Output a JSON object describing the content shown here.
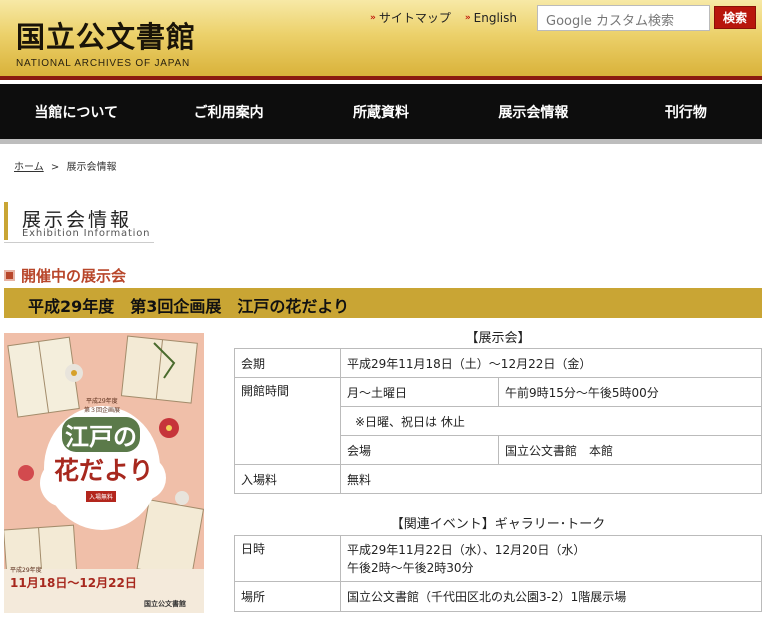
{
  "header": {
    "logo_jp": "国立公文書館",
    "logo_en": "NATIONAL ARCHIVES OF JAPAN",
    "links": [
      {
        "label": "サイトマップ"
      },
      {
        "label": "English"
      }
    ],
    "search_placeholder": "Google カスタム検索",
    "search_button": "検索"
  },
  "nav": {
    "items": [
      {
        "label": "当館について"
      },
      {
        "label": "ご利用案内"
      },
      {
        "label": "所蔵資料"
      },
      {
        "label": "展示会情報"
      },
      {
        "label": "刊行物"
      }
    ]
  },
  "breadcrumb": {
    "home": "ホーム",
    "separator": ">",
    "current": "展示会情報"
  },
  "page_title": {
    "jp": "展示会情報",
    "en": "Exhibition Information"
  },
  "section": {
    "heading": "開催中の展示会"
  },
  "exhibition": {
    "title": "平成29年度　第3回企画展　江戸の花だより",
    "poster": {
      "small_top": "平成29年度",
      "small_sub": "第３回企画展",
      "title_line1": "江戸の",
      "title_line2": "花だより",
      "badge": "入場無料",
      "year": "平成29年度",
      "date_start": "11月18日",
      "date_end": "12月22日",
      "footer_name": "国立公文書館"
    },
    "table1": {
      "caption": "【展示会】",
      "rows": {
        "period_label": "会期",
        "period_value": "平成29年11月18日（土）～12月22日（金）",
        "hours_label": "開館時間",
        "hours_days": "月～土曜日",
        "hours_time": "午前9時15分～午後5時00分",
        "hours_note": "※日曜、祝日は 休止",
        "venue_label": "会場",
        "venue_value": "国立公文書館　本館",
        "fee_label": "入場料",
        "fee_value": "無料"
      }
    },
    "table2": {
      "caption": "【関連イベント】ギャラリー･トーク",
      "rows": {
        "date_label": "日時",
        "date_value1": "平成29年11月22日（水）、12月20日（水）",
        "date_value2": "午後2時～午後2時30分",
        "place_label": "場所",
        "place_value": "国立公文書館（千代田区北の丸公園3-2）1階展示場"
      }
    }
  }
}
